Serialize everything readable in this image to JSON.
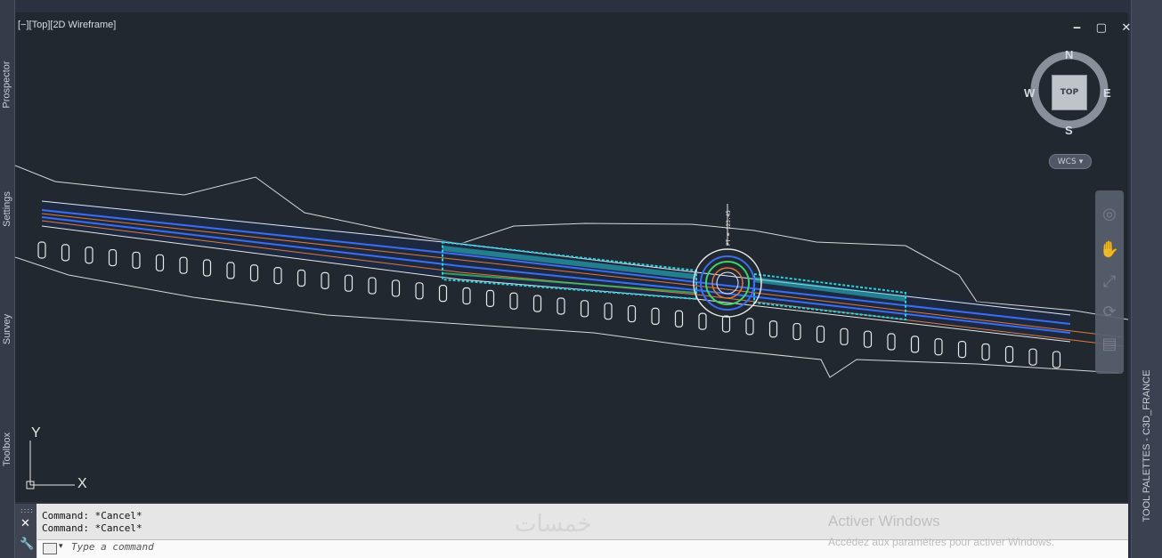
{
  "viewport": {
    "label": "[−][Top][2D Wireframe]",
    "window_controls": "‒ ▢ ✕"
  },
  "viewcube": {
    "north": "N",
    "south": "S",
    "east": "E",
    "west": "W",
    "top_face": "TOP",
    "wcs_label": "WCS",
    "wcs_icon": "chevron-down-icon"
  },
  "left_palette_tabs": [
    "Prospector",
    "Settings",
    "Survey",
    "Toolbox"
  ],
  "right_palette_title": "TOOL PALETTES - C3D_FRANCE",
  "drawing": {
    "station_label_main": "PT = 123.45",
    "ucs_x": "X",
    "ucs_y": "Y"
  },
  "command": {
    "history": [
      "Command: *Cancel*",
      "Command: *Cancel*"
    ],
    "placeholder": "Type a command",
    "close_icon": "close-icon",
    "customize_icon": "wrench-icon"
  },
  "activation": {
    "title": "Activer Windows",
    "subtitle": "Accédez aux paramètres pour activer Windows."
  },
  "watermark": "خمسات",
  "colors": {
    "background": "#212830",
    "road_white": "#e8e8e8",
    "road_cyan": "#2ad3e0",
    "road_blue": "#3b6ef0",
    "road_orange": "#e07a3a",
    "road_green": "#3fd36a"
  }
}
